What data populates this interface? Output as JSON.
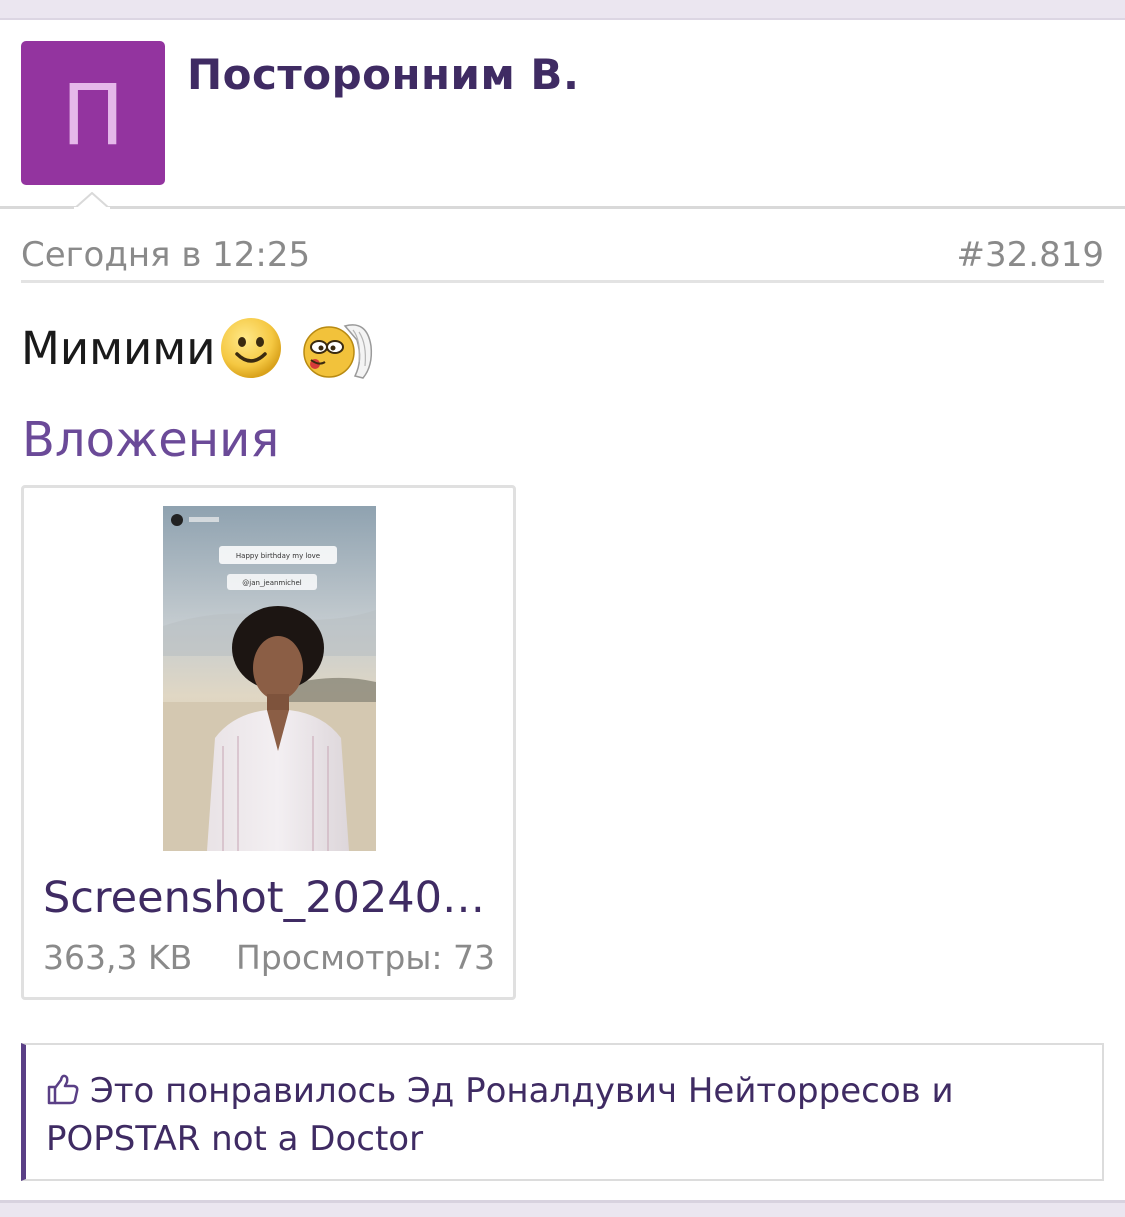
{
  "post": {
    "author_initial": "П",
    "author_name": "Посторонним В.",
    "date": "Сегодня в 12:25",
    "number": "#32.819",
    "message": "Мимими"
  },
  "attachments": {
    "title": "Вложения",
    "file": {
      "name": "Screenshot_20240112-122345.jpg",
      "size": "363,3 KB",
      "views_label": "Просмотры: 73"
    },
    "thumbnail_text": {
      "line1": "Happy birthday my love",
      "line2": "@jan_jeanmichel"
    }
  },
  "likes": {
    "text": "Это понравилось Эд Роналдувич Нейторресов и POPSTAR not a Doctor"
  },
  "colors": {
    "accent": "#3f2b63",
    "avatar_bg": "#93349f",
    "attach_title": "#6b4a98",
    "muted": "#8a8a8a"
  },
  "icons": [
    "smiley-icon",
    "angel-smiley-icon",
    "thumbs-up-icon"
  ]
}
